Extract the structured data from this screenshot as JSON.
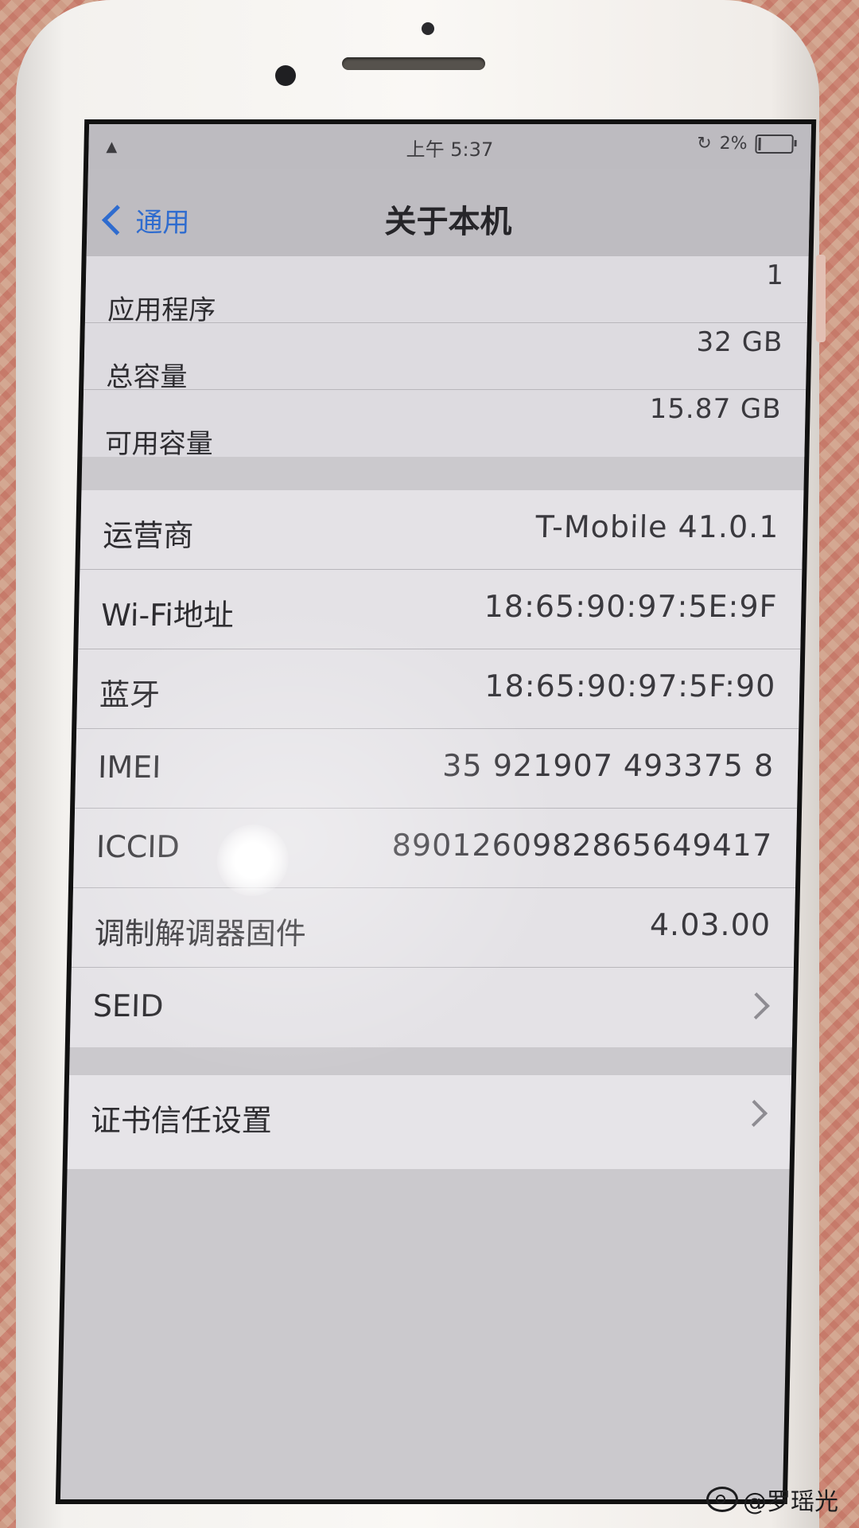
{
  "status_bar": {
    "time": "上午 5:37",
    "battery": "2%"
  },
  "nav": {
    "back_label": "通用",
    "title": "关于本机"
  },
  "storage_rows": [
    {
      "label": "应用程序",
      "value": "1"
    },
    {
      "label": "总容量",
      "value": "32 GB"
    },
    {
      "label": "可用容量",
      "value": "15.87 GB"
    }
  ],
  "network_rows": [
    {
      "label": "运营商",
      "value": "T-Mobile 41.0.1"
    },
    {
      "label": "Wi-Fi地址",
      "value": "18:65:90:97:5E:9F"
    },
    {
      "label": "蓝牙",
      "value": "18:65:90:97:5F:90"
    },
    {
      "label": "IMEI",
      "value": "35 921907 493375 8"
    },
    {
      "label": "ICCID",
      "value": "8901260982865649417"
    },
    {
      "label": "调制解调器固件",
      "value": "4.03.00"
    },
    {
      "label": "SEID",
      "value": ""
    }
  ],
  "settings_rows": [
    {
      "label": "证书信任设置"
    }
  ],
  "watermark": {
    "text": "@罗瑶光"
  },
  "colors": {
    "back_link": "#2f6ccf",
    "cell_background": "#dddbe0"
  },
  "icons": [
    "back-chevron-icon",
    "chevron-right-icon",
    "battery-icon",
    "weibo-icon"
  ]
}
